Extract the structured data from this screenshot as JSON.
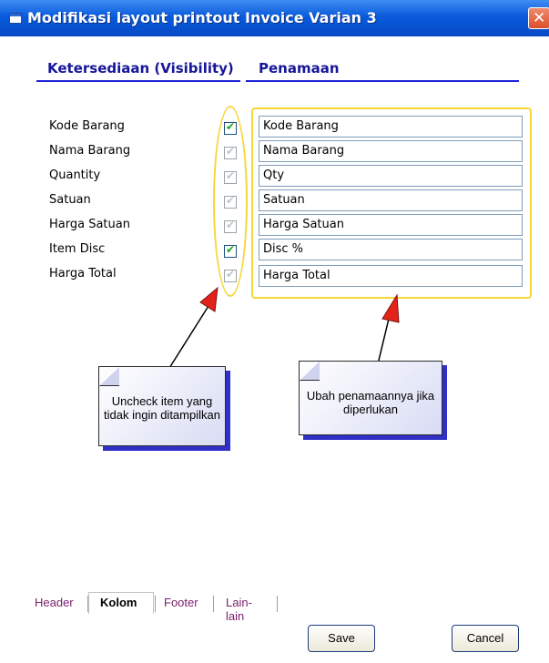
{
  "window": {
    "title": "Modifikasi layout printout Invoice Varian 3",
    "close_glyph": "✕"
  },
  "headers": {
    "visibility": "Ketersediaan (Visibility)",
    "naming": "Penamaan"
  },
  "columns": [
    {
      "label": "Kode Barang",
      "visible": true,
      "name": "Kode Barang"
    },
    {
      "label": "Nama Barang",
      "visible": false,
      "name": "Nama Barang"
    },
    {
      "label": "Quantity",
      "visible": false,
      "name": "Qty"
    },
    {
      "label": "Satuan",
      "visible": false,
      "name": "Satuan"
    },
    {
      "label": "Harga Satuan",
      "visible": false,
      "name": "Harga Satuan"
    },
    {
      "label": "Item Disc",
      "visible": true,
      "name": "Disc %"
    },
    {
      "label": "Harga Total",
      "visible": false,
      "name": "Harga Total"
    }
  ],
  "callouts": {
    "uncheck": "Uncheck item yang tidak ingin ditampilkan",
    "rename": "Ubah penamaannya jika diperlukan"
  },
  "tabs": [
    {
      "label": "Header",
      "active": false
    },
    {
      "label": "Kolom",
      "active": true
    },
    {
      "label": "Footer",
      "active": false
    },
    {
      "label": "Lain-lain",
      "active": false
    }
  ],
  "buttons": {
    "save": "Save",
    "cancel": "Cancel"
  },
  "colors": {
    "titlebar": "#0a5bdc",
    "header_text": "#16169c",
    "highlight": "#f7d63a",
    "arrow": "#e2231a",
    "callout_shadow": "#3030c8"
  }
}
